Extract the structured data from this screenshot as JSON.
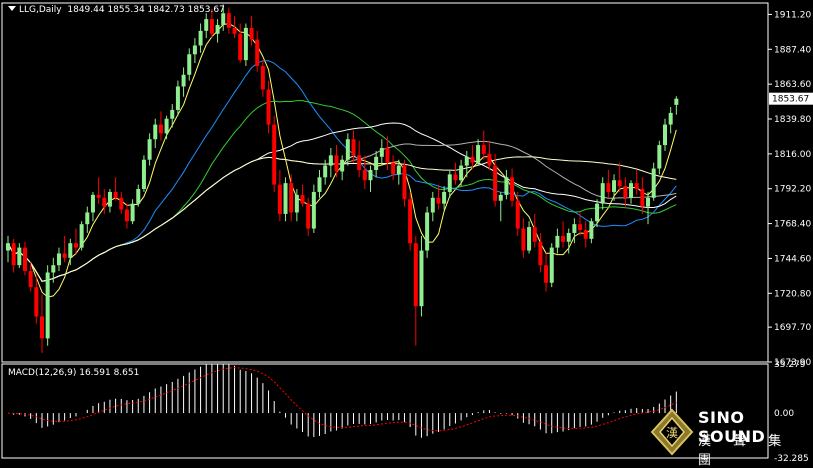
{
  "header": {
    "symbol": "LLG,Daily",
    "ohlc": "1849.44 1855.34 1842.73 1853.67",
    "macd_label": "MACD(12,26,9) 16.591 8.651"
  },
  "logo": {
    "text": "SINO SOUND",
    "chinese": "漢 聲 集 團"
  },
  "colors": {
    "background": "#000000",
    "bull": "#90ee90",
    "bear": "#ff0000",
    "ma_yellow": "#ffff66",
    "ma_green": "#33cc33",
    "ma_blue": "#1e90ff",
    "ma_white": "#ffffff",
    "ma_gray": "#b0b0b0",
    "ma_lightyellow": "#ffffcc",
    "macd_hist": "#ffffff",
    "macd_signal": "#ff0000",
    "axis_text": "#ffffff",
    "price_tag_bg": "#ffffff"
  },
  "chart_data": [
    {
      "type": "candlestick",
      "ylim": [
        1673.9,
        1919
      ],
      "ticks": [
        "1911.20",
        "1887.40",
        "1863.60",
        "1839.80",
        "1816.00",
        "1792.20",
        "1768.40",
        "1744.60",
        "1720.80",
        "1697.70",
        "1673.90"
      ],
      "last_price": "1853.67",
      "candles": [
        [
          1750,
          1760,
          1742,
          1755
        ],
        [
          1755,
          1758,
          1735,
          1740
        ],
        [
          1740,
          1755,
          1738,
          1752
        ],
        [
          1752,
          1756,
          1733,
          1736
        ],
        [
          1736,
          1742,
          1722,
          1725
        ],
        [
          1725,
          1733,
          1700,
          1705
        ],
        [
          1705,
          1720,
          1680,
          1690
        ],
        [
          1690,
          1740,
          1685,
          1735
        ],
        [
          1735,
          1745,
          1728,
          1740
        ],
        [
          1740,
          1752,
          1736,
          1748
        ],
        [
          1748,
          1760,
          1742,
          1745
        ],
        [
          1745,
          1758,
          1740,
          1755
        ],
        [
          1755,
          1765,
          1748,
          1752
        ],
        [
          1752,
          1770,
          1750,
          1768
        ],
        [
          1768,
          1780,
          1762,
          1776
        ],
        [
          1776,
          1790,
          1770,
          1788
        ],
        [
          1788,
          1800,
          1782,
          1786
        ],
        [
          1786,
          1792,
          1775,
          1780
        ],
        [
          1780,
          1792,
          1776,
          1790
        ],
        [
          1790,
          1800,
          1784,
          1786
        ],
        [
          1786,
          1790,
          1775,
          1778
        ],
        [
          1778,
          1782,
          1765,
          1770
        ],
        [
          1770,
          1785,
          1768,
          1782
        ],
        [
          1782,
          1795,
          1780,
          1792
        ],
        [
          1792,
          1815,
          1790,
          1812
        ],
        [
          1812,
          1830,
          1808,
          1826
        ],
        [
          1826,
          1840,
          1820,
          1836
        ],
        [
          1836,
          1845,
          1825,
          1830
        ],
        [
          1830,
          1842,
          1826,
          1840
        ],
        [
          1840,
          1850,
          1834,
          1846
        ],
        [
          1846,
          1866,
          1842,
          1862
        ],
        [
          1862,
          1875,
          1855,
          1870
        ],
        [
          1870,
          1888,
          1866,
          1884
        ],
        [
          1884,
          1895,
          1878,
          1890
        ],
        [
          1890,
          1905,
          1885,
          1900
        ],
        [
          1900,
          1912,
          1895,
          1908
        ],
        [
          1908,
          1915,
          1895,
          1898
        ],
        [
          1898,
          1908,
          1892,
          1904
        ],
        [
          1904,
          1918,
          1900,
          1912
        ],
        [
          1912,
          1916,
          1898,
          1902
        ],
        [
          1902,
          1910,
          1895,
          1898
        ],
        [
          1898,
          1905,
          1878,
          1880
        ],
        [
          1880,
          1905,
          1876,
          1902
        ],
        [
          1902,
          1910,
          1890,
          1894
        ],
        [
          1894,
          1900,
          1872,
          1876
        ],
        [
          1876,
          1880,
          1855,
          1860
        ],
        [
          1860,
          1866,
          1830,
          1836
        ],
        [
          1836,
          1842,
          1790,
          1795
        ],
        [
          1795,
          1805,
          1770,
          1775
        ],
        [
          1775,
          1800,
          1770,
          1796
        ],
        [
          1796,
          1802,
          1770,
          1776
        ],
        [
          1776,
          1792,
          1770,
          1788
        ],
        [
          1788,
          1795,
          1780,
          1782
        ],
        [
          1782,
          1786,
          1760,
          1765
        ],
        [
          1765,
          1795,
          1762,
          1790
        ],
        [
          1790,
          1805,
          1786,
          1800
        ],
        [
          1800,
          1812,
          1795,
          1808
        ],
        [
          1808,
          1820,
          1800,
          1815
        ],
        [
          1815,
          1822,
          1800,
          1804
        ],
        [
          1804,
          1815,
          1798,
          1812
        ],
        [
          1812,
          1830,
          1808,
          1826
        ],
        [
          1826,
          1832,
          1810,
          1815
        ],
        [
          1815,
          1825,
          1800,
          1805
        ],
        [
          1805,
          1815,
          1792,
          1798
        ],
        [
          1798,
          1808,
          1790,
          1805
        ],
        [
          1805,
          1818,
          1800,
          1814
        ],
        [
          1814,
          1826,
          1808,
          1820
        ],
        [
          1820,
          1828,
          1805,
          1810
        ],
        [
          1810,
          1815,
          1798,
          1802
        ],
        [
          1802,
          1812,
          1795,
          1808
        ],
        [
          1808,
          1812,
          1780,
          1785
        ],
        [
          1785,
          1790,
          1750,
          1755
        ],
        [
          1755,
          1760,
          1685,
          1712
        ],
        [
          1712,
          1760,
          1705,
          1750
        ],
        [
          1750,
          1780,
          1745,
          1776
        ],
        [
          1776,
          1790,
          1770,
          1786
        ],
        [
          1786,
          1795,
          1778,
          1782
        ],
        [
          1782,
          1794,
          1778,
          1790
        ],
        [
          1790,
          1805,
          1786,
          1802
        ],
        [
          1802,
          1810,
          1795,
          1798
        ],
        [
          1798,
          1812,
          1794,
          1808
        ],
        [
          1808,
          1818,
          1800,
          1814
        ],
        [
          1814,
          1822,
          1806,
          1810
        ],
        [
          1810,
          1826,
          1808,
          1822
        ],
        [
          1822,
          1832,
          1812,
          1816
        ],
        [
          1816,
          1825,
          1805,
          1808
        ],
        [
          1808,
          1816,
          1780,
          1784
        ],
        [
          1784,
          1790,
          1770,
          1788
        ],
        [
          1788,
          1805,
          1785,
          1800
        ],
        [
          1800,
          1806,
          1780,
          1784
        ],
        [
          1784,
          1790,
          1760,
          1765
        ],
        [
          1765,
          1772,
          1745,
          1750
        ],
        [
          1750,
          1770,
          1748,
          1766
        ],
        [
          1766,
          1775,
          1752,
          1756
        ],
        [
          1756,
          1762,
          1735,
          1740
        ],
        [
          1740,
          1748,
          1722,
          1728
        ],
        [
          1728,
          1755,
          1725,
          1752
        ],
        [
          1752,
          1765,
          1748,
          1760
        ],
        [
          1760,
          1770,
          1752,
          1756
        ],
        [
          1756,
          1765,
          1748,
          1762
        ],
        [
          1762,
          1772,
          1755,
          1768
        ],
        [
          1768,
          1776,
          1760,
          1764
        ],
        [
          1764,
          1770,
          1752,
          1758
        ],
        [
          1758,
          1772,
          1755,
          1770
        ],
        [
          1770,
          1785,
          1766,
          1782
        ],
        [
          1782,
          1800,
          1778,
          1796
        ],
        [
          1796,
          1805,
          1786,
          1790
        ],
        [
          1790,
          1802,
          1784,
          1798
        ],
        [
          1798,
          1810,
          1790,
          1794
        ],
        [
          1794,
          1800,
          1780,
          1786
        ],
        [
          1786,
          1798,
          1782,
          1796
        ],
        [
          1796,
          1805,
          1788,
          1792
        ],
        [
          1792,
          1800,
          1775,
          1780
        ],
        [
          1780,
          1790,
          1768,
          1786
        ],
        [
          1786,
          1810,
          1784,
          1806
        ],
        [
          1806,
          1825,
          1802,
          1822
        ],
        [
          1822,
          1840,
          1818,
          1836
        ],
        [
          1836,
          1848,
          1830,
          1844
        ],
        [
          1849.44,
          1855.34,
          1842.73,
          1853.67
        ]
      ]
    },
    {
      "type": "macd",
      "ylim": [
        -32.285,
        35.279
      ],
      "ticks": [
        "35.279",
        "0.00",
        "-32.285"
      ]
    }
  ]
}
